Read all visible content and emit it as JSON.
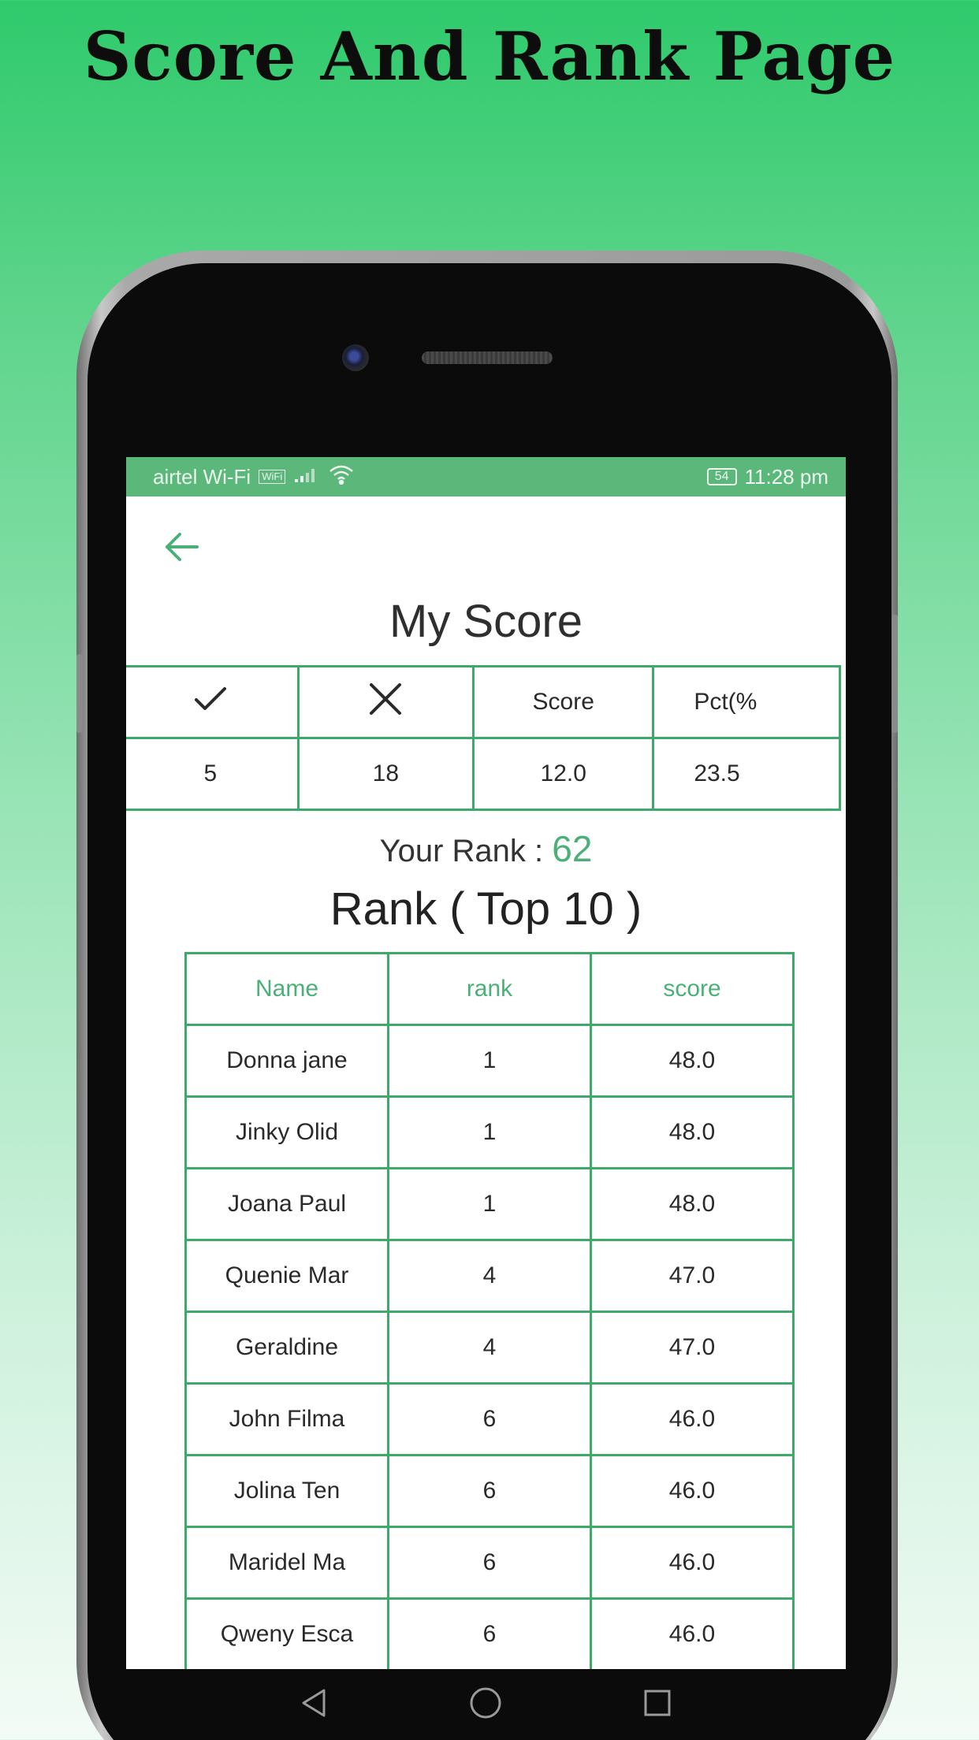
{
  "promo": {
    "title": "Score And Rank Page"
  },
  "status_bar": {
    "carrier": "airtel Wi-Fi",
    "wifi_badge": "WiFi",
    "battery": "54",
    "time": "11:28 pm"
  },
  "icons": {
    "back": "arrow-left-icon",
    "correct": "check-icon",
    "wrong": "close-icon",
    "nav_back": "triangle-back-icon",
    "nav_home": "circle-home-icon",
    "nav_recent": "square-recents-icon"
  },
  "colors": {
    "accent": "#3daa69",
    "status_bar": "#5cb77b",
    "rank_value": "#4bb077"
  },
  "my_score": {
    "title": "My Score",
    "headers": {
      "score": "Score",
      "pct": "Pct(%"
    },
    "values": {
      "correct": "5",
      "wrong": "18",
      "score": "12.0",
      "pct": "23.5"
    }
  },
  "your_rank": {
    "label": "Your Rank : ",
    "value": "62"
  },
  "top10": {
    "title": "Rank ( Top 10 )",
    "columns": [
      "Name",
      "rank",
      "score"
    ],
    "rows": [
      [
        "Donna jane",
        "1",
        "48.0"
      ],
      [
        "Jinky Olid",
        "1",
        "48.0"
      ],
      [
        "Joana Paul",
        "1",
        "48.0"
      ],
      [
        "Quenie Mar",
        "4",
        "47.0"
      ],
      [
        "Geraldine",
        "4",
        "47.0"
      ],
      [
        "John Filma",
        "6",
        "46.0"
      ],
      [
        "Jolina Ten",
        "6",
        "46.0"
      ],
      [
        "Maridel Ma",
        "6",
        "46.0"
      ],
      [
        "Qweny Esca",
        "6",
        "46.0"
      ]
    ]
  }
}
